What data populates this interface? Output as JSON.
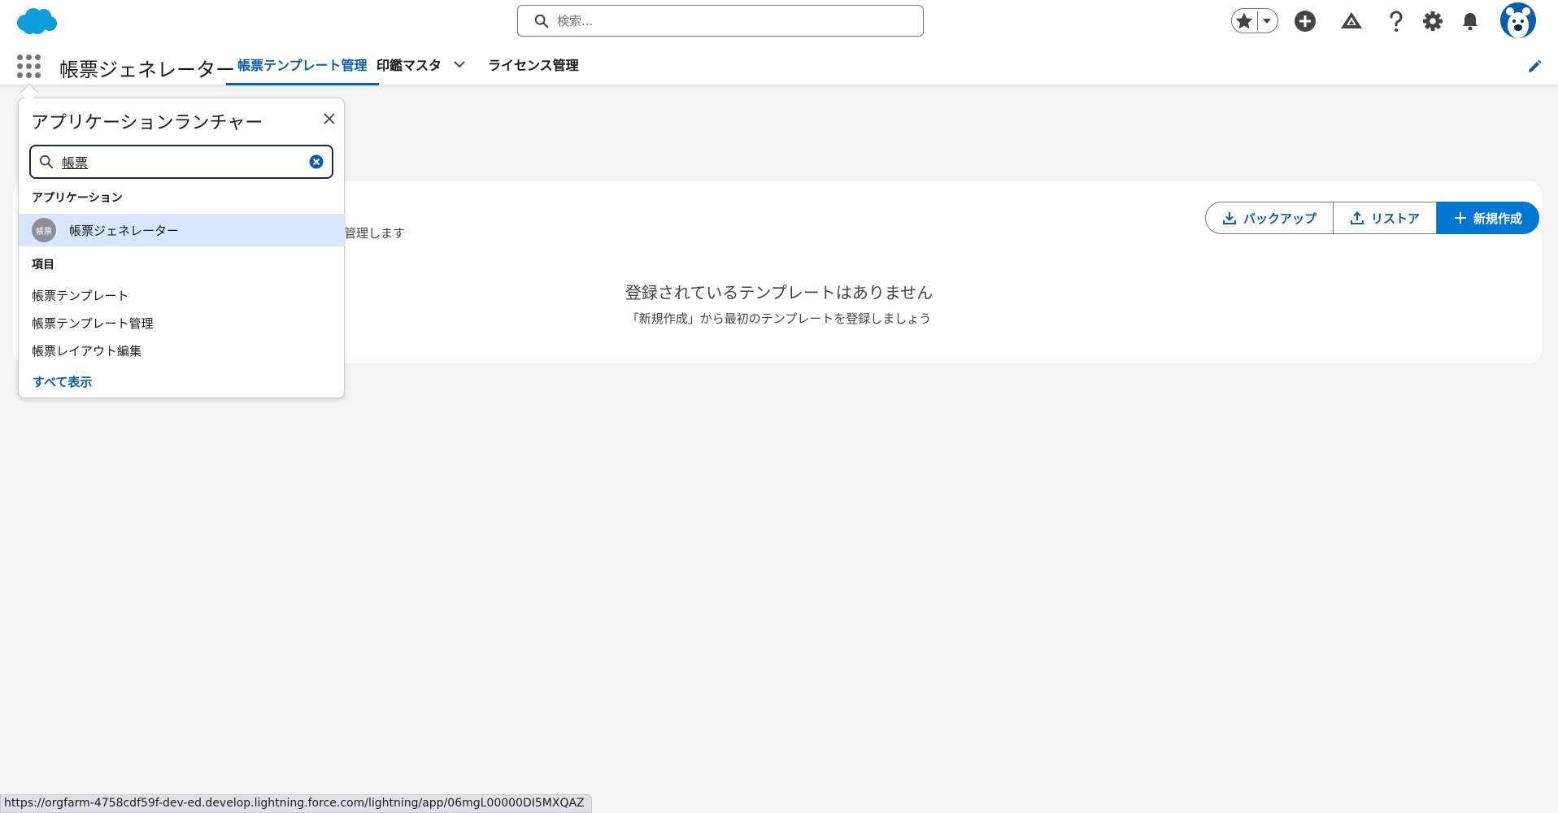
{
  "global_header": {
    "search_placeholder": "検索...",
    "icons": [
      "favorites-star-icon",
      "chevron-down-icon",
      "add-icon",
      "trailhead-icon",
      "help-icon",
      "setup-gear-icon",
      "notifications-bell-icon",
      "user-avatar"
    ]
  },
  "context_bar": {
    "app_name": "帳票ジェネレーター",
    "tabs": [
      {
        "label": "帳票テンプレート管理",
        "active": true
      },
      {
        "label": "印鑑マスタ",
        "active": false,
        "has_menu": true
      },
      {
        "label": "ライセンス管理",
        "active": false
      }
    ]
  },
  "main": {
    "description_fragment": "管理します",
    "buttons": {
      "backup": "バックアップ",
      "restore": "リストア",
      "new": "新規作成"
    },
    "empty_title": "登録されているテンプレートはありません",
    "empty_subtitle": "「新規作成」から最初のテンプレートを登録しましょう"
  },
  "launcher": {
    "title": "アプリケーションランチャー",
    "search_value": "帳票",
    "sections": {
      "apps_label": "アプリケーション",
      "items_label": "項目"
    },
    "apps": [
      {
        "badge": "帳票",
        "label": "帳票ジェネレーター"
      }
    ],
    "items": [
      "帳票テンプレート",
      "帳票テンプレート管理",
      "帳票レイアウト編集"
    ],
    "show_all": "すべて表示"
  },
  "status_url": "https://orgfarm-4758cdf59f-dev-ed.develop.lightning.force.com/lightning/app/06mgL00000DI5MXQAZ",
  "colors": {
    "brand": "#0176d3",
    "brand_dark": "#0b5cab",
    "highlight": "#d8e6fe",
    "page_bg": "#f3f3f3"
  }
}
